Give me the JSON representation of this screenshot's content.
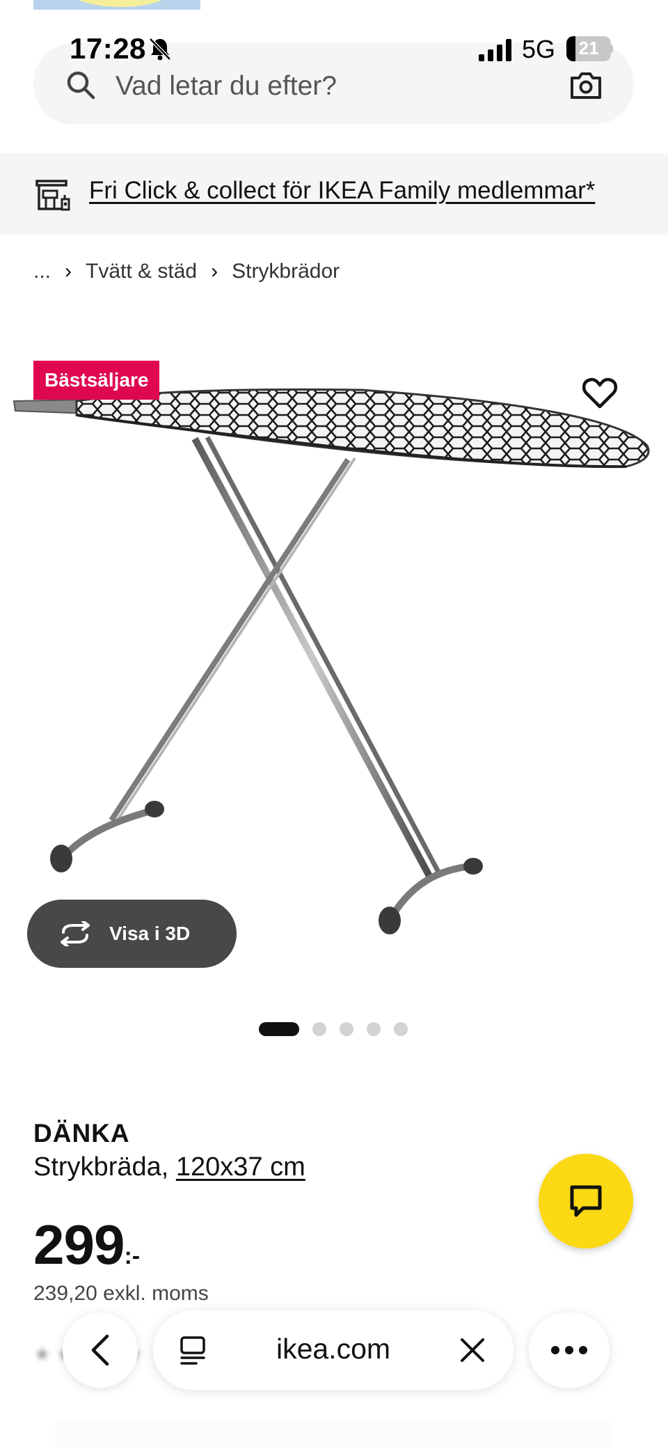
{
  "status_bar": {
    "time": "17:28",
    "network": "5G",
    "battery_level": "21",
    "battery_fraction": 0.21
  },
  "search": {
    "placeholder": "Vad letar du efter?",
    "value": ""
  },
  "promo": {
    "text": "Fri Click & collect för IKEA Family medlemmar*"
  },
  "breadcrumb": {
    "items": [
      "...",
      "Tvätt & städ",
      "Strykbrädor"
    ]
  },
  "product": {
    "badge": "Bästsäljare",
    "view_3d_label": "Visa i 3D",
    "name": "DÄNKA",
    "type": "Strykbräda,",
    "dimensions": "120x37 cm",
    "price_integer": "299",
    "price_suffix": ":-",
    "price_ex_vat": "239,20 exkl. moms",
    "image_count": 5,
    "active_image": 1
  },
  "browser": {
    "domain": "ikea.com"
  },
  "colors": {
    "accent_yellow": "#fbd914",
    "badge_red": "#e00751",
    "button_dark": "#484848",
    "banner_gray": "#f5f5f5"
  },
  "icons": [
    "search-icon",
    "camera-icon",
    "store-icon",
    "heart-icon",
    "rotate-3d-icon",
    "chat-icon",
    "back-chevron-icon",
    "reader-icon",
    "close-icon",
    "more-icon",
    "bell-slash-icon",
    "signal-icon"
  ]
}
